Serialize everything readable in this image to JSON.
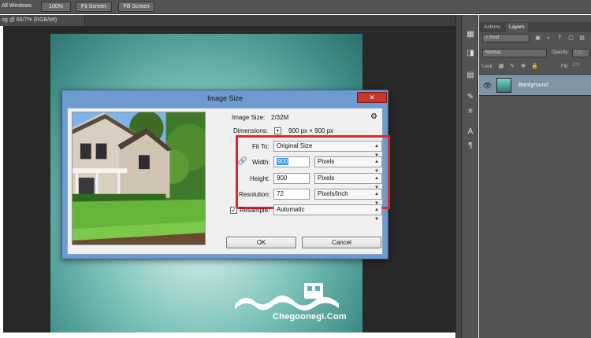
{
  "options_bar": {
    "scroll_all_windows_label": "All Windows",
    "zoom_100_label": "100%",
    "fit_screen_label": "Fit Screen",
    "fill_screen_label": "Fill Screen"
  },
  "document_tab": {
    "title": "og @ 66/7% (RGB/8#)"
  },
  "watermark": {
    "site": "Chegoonegi.Com"
  },
  "panel": {
    "tabs": [
      "Actions",
      "Layers"
    ],
    "kind_label": "Kind",
    "blend_mode": "Normal",
    "opacity_label": "Opacity:",
    "opacity_value": "100",
    "lock_label": "Lock:",
    "fill_label": "Fill:",
    "fill_value": "100",
    "layer_name": "Background"
  },
  "dialog": {
    "title": "Image Size",
    "close_label": "✕",
    "image_size_label": "Image Size:",
    "image_size_value": "2/32M",
    "dimensions_label": "Dimensions:",
    "dimensions_value": "900 px  ×  900 px",
    "fit_to_label": "Fit To:",
    "fit_to_value": "Original Size",
    "width_label": "Width:",
    "width_value": "900",
    "width_unit": "Pixels",
    "height_label": "Height:",
    "height_value": "900",
    "height_unit": "Pixels",
    "resolution_label": "Resolution:",
    "resolution_value": "72",
    "resolution_unit": "Pixels/Inch",
    "resample_label": "Resample:",
    "resample_checked": true,
    "resample_value": "Automatic",
    "ok_label": "OK",
    "cancel_label": "Cancel"
  },
  "colors": {
    "highlight_box": "#e0262c",
    "dialog_frame": "#6e9bcf",
    "layer_selected": "#7f93a7",
    "canvas_teal": "#3f8f88"
  }
}
